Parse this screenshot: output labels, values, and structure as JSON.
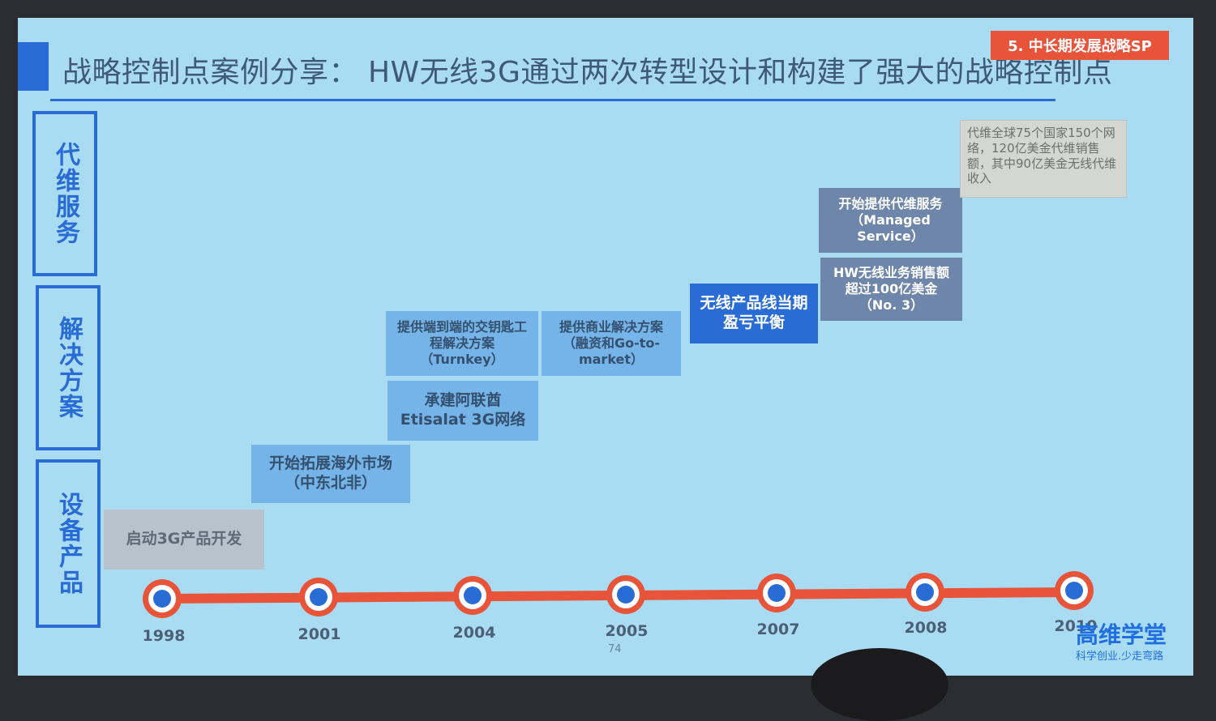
{
  "slide": {
    "title": "战略控制点案例分享：  HW无线3G通过两次转型设计和构建了强大的战略控制点",
    "tag": "5. 中长期发展战略SP",
    "page_number": "74"
  },
  "categories": [
    {
      "label": "代维服务"
    },
    {
      "label": "解决方案"
    },
    {
      "label": "设备产品"
    }
  ],
  "milestones": {
    "start_3g": "启动3G产品开发",
    "overseas": "开始拓展海外市场（中东北非）",
    "turnkey": "提供端到端的交钥匙工程解决方案（Turnkey）",
    "etisalat": "承建阿联酋Etisalat 3G网络",
    "commercial": "提供商业解决方案（融资和Go-to-market）",
    "breakeven": "无线产品线当期盈亏平衡",
    "sales": "HW无线业务销售额超过100亿美金（No. 3）",
    "managed": "开始提供代维服务（Managed Service）",
    "global": "代维全球75个国家150个网络，120亿美金代维销售额，其中90亿美金无线代维收入"
  },
  "timeline": {
    "years": [
      "1998",
      "2001",
      "2004",
      "2005",
      "2007",
      "2008",
      "2010"
    ]
  },
  "logo": {
    "name": "高维学堂",
    "slogan": "科学创业.少走弯路"
  },
  "colors": {
    "accent": "#2a6cd6",
    "timeline": "#e8543a",
    "background": "#a9dcf3"
  }
}
